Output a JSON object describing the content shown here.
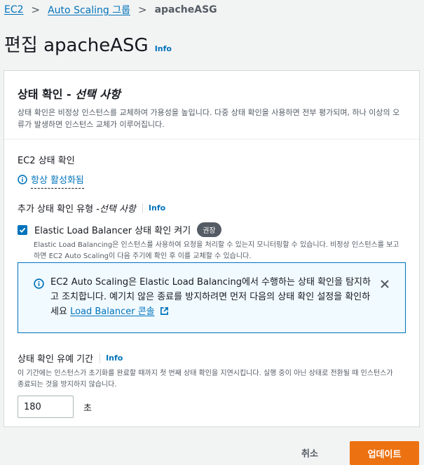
{
  "breadcrumb": {
    "items": [
      "EC2",
      "Auto Scaling 그룹"
    ],
    "current": "apacheASG",
    "separator": ">"
  },
  "page": {
    "title": "편집 apacheASG",
    "info": "Info"
  },
  "container": {
    "title_main": "상태 확인 - ",
    "title_optional": "선택 사항",
    "description": "상태 확인은 비정상 인스턴스를 교체하여 가용성을 높입니다. 다중 상태 확인을 사용하면 전부 평가되며, 하나 이상의 오류가 발생하면 인스턴스 교체가 이루어집니다."
  },
  "ec2_check": {
    "label": "EC2 상태 확인",
    "status": "항상 활성화됨"
  },
  "additional_checks": {
    "label_main": "추가 상태 확인 유형 - ",
    "label_optional": "선택 사항",
    "info": "Info",
    "elb": {
      "label": "Elastic Load Balancer 상태 확인 켜기",
      "badge": "권장",
      "checked": true,
      "description": "Elastic Load Balancing은 인스턴스를 사용하여 요청을 처리할 수 있는지 모니터링할 수 있습니다. 비정상 인스턴스를 보고하면 EC2 Auto Scaling이 다음 주기에 확인 후 이를 교체할 수 있습니다."
    }
  },
  "alert": {
    "text": "EC2 Auto Scaling은 Elastic Load Balancing에서 수행하는 상태 확인을 탐지하고 조치합니다. 예기치 않은 종료를 방지하려면 먼저 다음의 상태 확인 설정을 확인하세요 ",
    "link": "Load Balancer 콘솔"
  },
  "grace_period": {
    "label": "상태 확인 유예 기간",
    "info": "Info",
    "description": "이 기간에는 인스턴스가 초기화를 완료할 때까지 첫 번째 상태 확인을 지연시킵니다. 실행 중이 아닌 상태로 전환될 때 인스턴스가 종료되는 것을 방지하지 않습니다.",
    "value": "180",
    "unit": "초"
  },
  "footer": {
    "cancel": "취소",
    "update": "업데이트"
  },
  "colors": {
    "link": "#0073bb",
    "primary_button": "#ec7211",
    "alert_bg": "#f1faff",
    "badge": "#545b64"
  },
  "icons": [
    "info-circle-icon",
    "check-icon",
    "close-icon",
    "external-link-icon"
  ]
}
